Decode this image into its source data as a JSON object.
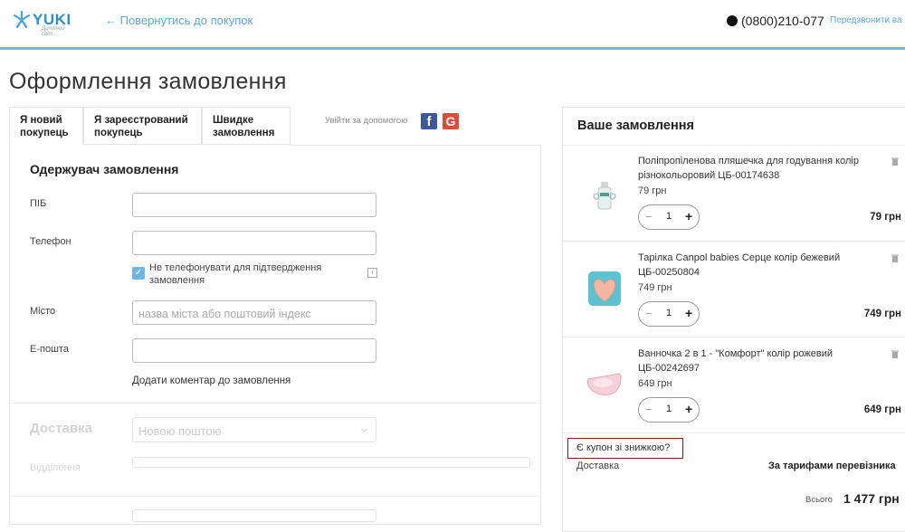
{
  "header": {
    "logo_text": "YUKI",
    "logo_sub": "Дитячий світ",
    "back_link": "← Повернутись до покупок",
    "phone": "(0800)210-077",
    "callback": "Передзвонити ва"
  },
  "page_title": "Оформлення замовлення",
  "tabs": [
    {
      "line1": "Я новий",
      "line2": "покупець"
    },
    {
      "line1": "Я зареєстрований",
      "line2": "покупець"
    },
    {
      "line1": "Швидке",
      "line2": "замовлення"
    }
  ],
  "social": {
    "label": "Увійти за допомогою",
    "facebook": "f",
    "google": "G"
  },
  "recipient": {
    "title": "Одержувач замовлення",
    "name_label": "ПІБ",
    "name_value": "",
    "phone_label": "Телефон",
    "phone_value": "",
    "no_call_label": "Не телефонувати для підтвердження замовлення",
    "info_glyph": "i",
    "city_label": "Місто",
    "city_placeholder": "назва міста або поштовий індекс",
    "email_label": "E-пошта",
    "email_value": "",
    "comment_link": "Додати коментар до замовлення"
  },
  "delivery": {
    "title": "Доставка",
    "method": "Новою поштою",
    "branch_label": "Відділення"
  },
  "order": {
    "title": "Ваше замовлення",
    "items": [
      {
        "name": "Поліпропіленова пляшечка для годування колір різнокольоровий ЦБ-00174638",
        "price": "79 грн",
        "qty": "1",
        "total": "79 грн"
      },
      {
        "name": "Тарілка Canpol babies Серце колір бежевий ЦБ-00250804",
        "price": "749 грн",
        "qty": "1",
        "total": "749 грн"
      },
      {
        "name": "Ванночка 2 в 1 - \"Комфорт\" колір рожевий ЦБ-00242697",
        "price": "649 грн",
        "qty": "1",
        "total": "649 грн"
      }
    ],
    "stepper_minus": "−",
    "stepper_plus": "+",
    "coupon": "Є купон зі знижкою?",
    "shipping_label": "Доставка",
    "shipping_value": "За тарифами перевізника",
    "total_label": "Всього",
    "total_value": "1 477 грн"
  },
  "colors": {
    "accent": "#6fb7de",
    "link": "#5aa9d6",
    "coupon_border": "#8b1a1a",
    "facebook": "#3b5998",
    "google": "#dd4b39"
  }
}
